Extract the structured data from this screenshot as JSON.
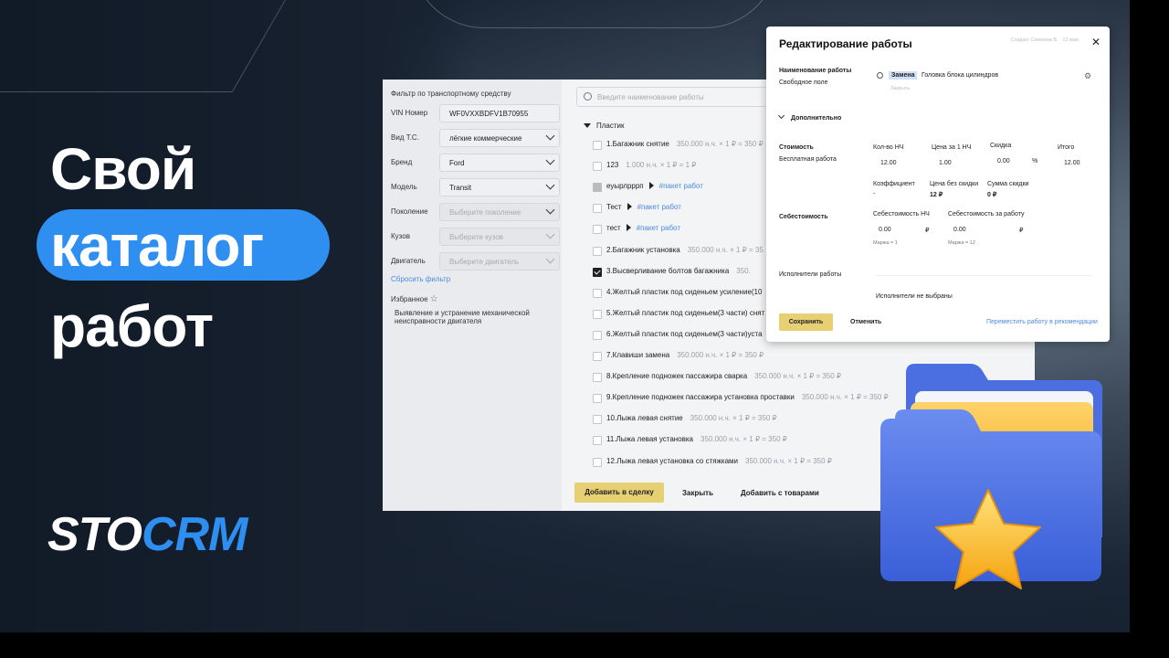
{
  "promo": {
    "line1": "Свой",
    "line2": "каталог",
    "line3": "работ",
    "logo_part1": "STO",
    "logo_part2": "CRM",
    "brand_color": "#2e8ff0"
  },
  "filter": {
    "title": "Фильтр по транспортному средству",
    "vin_label": "VIN Номер",
    "vin_value": "WF0VXXBDFV1B70955",
    "fields": [
      {
        "label": "Вид Т.С.",
        "value": "лёгкие коммерческие"
      },
      {
        "label": "Бренд",
        "value": "Ford"
      },
      {
        "label": "Модель",
        "value": "Transit"
      },
      {
        "label": "Поколение",
        "value": "Выберите поколение"
      },
      {
        "label": "Кузов",
        "value": "Выберите кузов"
      },
      {
        "label": "Двигатель",
        "value": "Выберите двигатель"
      }
    ],
    "reset": "Сбросить фильтр",
    "favorites": "Избранное",
    "favorite_item": "Выявление и устранение механической неисправности двигателя"
  },
  "catalog": {
    "search_placeholder": "Введите наименование работы",
    "group": "Пластик",
    "rows": [
      {
        "name": "1.Багажник снятие",
        "price": "350.000 н.ч. × 1 ₽ = 350 ₽",
        "tag": "",
        "state": "off"
      },
      {
        "name": "123",
        "price": "1.000 н.ч. × 1 ₽ = 1 ₽",
        "tag": "",
        "state": "off"
      },
      {
        "name": "еуырлрррп",
        "price": "",
        "tag": "#пакет работ",
        "state": "grey"
      },
      {
        "name": "Тест",
        "price": "",
        "tag": "#пакет работ",
        "state": "off"
      },
      {
        "name": "тест",
        "price": "",
        "tag": "#пакет работ",
        "state": "off"
      },
      {
        "name": "2.Багажник установка",
        "price": "350.000 н.ч. × 1 ₽ = 35",
        "tag": "",
        "state": "off"
      },
      {
        "name": "3.Высверливание болтов багажника",
        "price": "350.",
        "tag": "",
        "state": "on"
      },
      {
        "name": "4.Желтый пластик под сиденьем усиление(10",
        "price": "",
        "tag": "",
        "state": "off"
      },
      {
        "name": "5.Желтый пластик под сиденьем(3 части) снят",
        "price": "",
        "tag": "",
        "state": "off"
      },
      {
        "name": "6.Желтый пластик под сиденьем(3 части)уста",
        "price": "",
        "tag": "",
        "state": "off"
      },
      {
        "name": "7.Клавиши замена",
        "price": "350.000 н.ч. × 1 ₽ = 350 ₽",
        "tag": "",
        "state": "off"
      },
      {
        "name": "8.Крепление подножек пассажира сварка",
        "price": "350.000 н.ч. × 1 ₽ = 350 ₽",
        "tag": "",
        "state": "off"
      },
      {
        "name": "9.Крепление подножек пассажира установка проставки",
        "price": "350.000 н.ч. × 1 ₽ = 350 ₽",
        "tag": "",
        "state": "off"
      },
      {
        "name": "10.Лыжа левая снятие",
        "price": "350.000 н.ч. × 1 ₽ = 350 ₽",
        "tag": "",
        "state": "off"
      },
      {
        "name": "11.Лыжа левая установка",
        "price": "350.000 н.ч. × 1 ₽ = 350 ₽",
        "tag": "",
        "state": "off"
      },
      {
        "name": "12.Лыжа левая установка со стяжками",
        "price": "350.000 н.ч. × 1 ₽ = 350 ₽",
        "tag": "",
        "state": "off"
      }
    ],
    "add_to_deal": "Добавить в сделку",
    "close": "Закрыть",
    "add_with_goods": "Добавить с товарами"
  },
  "modal": {
    "title": "Редактирование работы",
    "top_hint": "Создал: Семенов В. · 12 мая",
    "name_label": "Наименование работы",
    "free_field": "Свободное поле",
    "tag": "Замена",
    "name_value": "Головка блока цилиндров",
    "name_hint": "Закрыть",
    "extra": "Дополнительно",
    "cost_label": "Стоимость",
    "free_work": "Бесплатная работа",
    "qty_label": "Кол-во НЧ",
    "qty_value": "12.00",
    "price_label": "Цена за 1 НЧ",
    "price_value": "1.00",
    "discount_label": "Скидка",
    "discount_value": "0.00",
    "percent": "%",
    "total_label": "Итого",
    "total_value": "12.00",
    "coef_label": "Коэффициент",
    "coef_value": "-",
    "nodisc_label": "Цена без скидки",
    "nodisc_value": "12 ₽",
    "discsum_label": "Сумма скидки",
    "discsum_value": "0 ₽",
    "selfcost_label": "Себестоимость",
    "selfcost_nh_label": "Себестоимость НЧ",
    "selfcost_nh_value": "0.00",
    "selfcost_work_label": "Себестоимость за работу",
    "selfcost_work_value": "0.00",
    "rub": "₽",
    "margin1": "Маржа = 1",
    "margin2": "Маржа = 12",
    "executors_label": "Исполнители работы",
    "executors_none": "Исполнители не выбраны",
    "save": "Сохранить",
    "cancel": "Отменить",
    "move": "Переместить работу в рекомендации"
  }
}
